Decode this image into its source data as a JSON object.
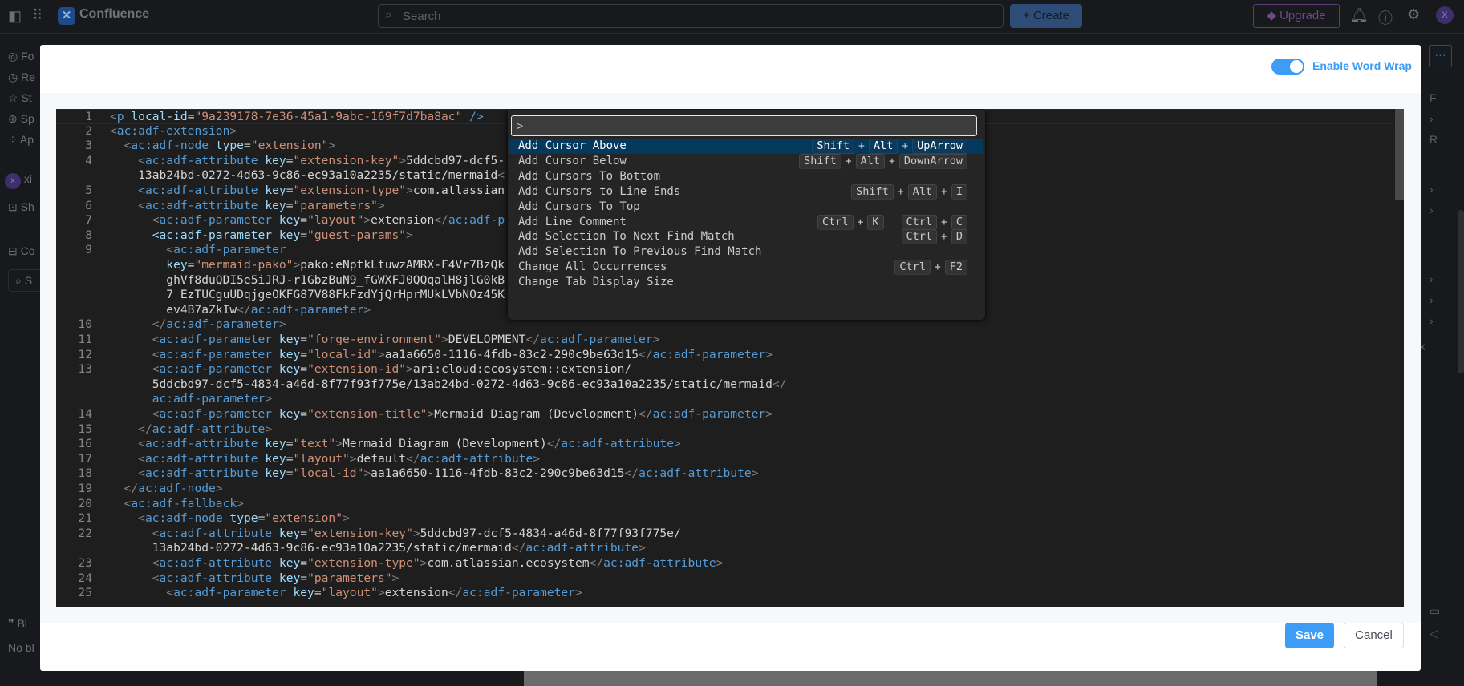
{
  "topbar": {
    "app_name": "Confluence",
    "search_placeholder": "Search",
    "create_label": "+ Create",
    "upgrade_label": "Upgrade",
    "avatar_initial": "X"
  },
  "sidebar": {
    "items": [
      "Fo",
      "Re",
      "St",
      "Sp",
      "Ap"
    ],
    "user": "xi",
    "user_initial": "x",
    "shortcut": "Sh",
    "content": "Co",
    "search": "S",
    "blog": "Bl",
    "no_blog": "No bl"
  },
  "right_panel": {
    "items": [
      "F",
      "R",
      "k"
    ]
  },
  "modal": {
    "word_wrap_label": "Enable Word Wrap",
    "word_wrap_enabled": true,
    "save_label": "Save",
    "cancel_label": "Cancel"
  },
  "editor": {
    "rows": [
      {
        "n": "1",
        "t": "<p local-id=\"9a239178-7e36-45a1-9abc-169f7d7ba8ac\" />"
      },
      {
        "n": "2",
        "t": "<ac:adf-extension>"
      },
      {
        "n": "3",
        "t": "  <ac:adf-node type=\"extension\">"
      },
      {
        "n": "4",
        "t": "    <ac:adf-attribute key=\"extension-key\">5ddcbd97-dcf5-"
      },
      {
        "n": "",
        "t": "    13ab24bd-0272-4d63-9c86-ec93a10a2235/static/mermaid<"
      },
      {
        "n": "5",
        "t": "    <ac:adf-attribute key=\"extension-type\">com.atlassian"
      },
      {
        "n": "6",
        "t": "    <ac:adf-attribute key=\"parameters\">"
      },
      {
        "n": "7",
        "t": "      <ac:adf-parameter key=\"layout\">extension</ac:adf-p"
      },
      {
        "n": "8",
        "t": "      <ac:adf-parameter key=\"guest-params\">"
      },
      {
        "n": "9",
        "t": "        <ac:adf-parameter"
      },
      {
        "n": "",
        "t": "        key=\"mermaid-pako\">pako:eNptkLtuwzAMRX-F4Vr7BzQk"
      },
      {
        "n": "",
        "t": "        ghVf8duQDI5e5iJRJ-r1GbzBuN9_fGWXFJ0QQqalH8jlG0kB"
      },
      {
        "n": "",
        "t": "        7_EzTUCguUDqjgeOKFG87V88FkFzdYjQrHprMUkLVbNOz45K"
      },
      {
        "n": "",
        "t": "        ev4B7aZkIw</ac:adf-parameter>"
      },
      {
        "n": "10",
        "t": "      </ac:adf-parameter>"
      },
      {
        "n": "11",
        "t": "      <ac:adf-parameter key=\"forge-environment\">DEVELOPMENT</ac:adf-parameter>"
      },
      {
        "n": "12",
        "t": "      <ac:adf-parameter key=\"local-id\">aa1a6650-1116-4fdb-83c2-290c9be63d15</ac:adf-parameter>"
      },
      {
        "n": "13",
        "t": "      <ac:adf-parameter key=\"extension-id\">ari:cloud:ecosystem::extension/"
      },
      {
        "n": "",
        "t": "      5ddcbd97-dcf5-4834-a46d-8f77f93f775e/13ab24bd-0272-4d63-9c86-ec93a10a2235/static/mermaid</"
      },
      {
        "n": "",
        "t": "      ac:adf-parameter>"
      },
      {
        "n": "14",
        "t": "      <ac:adf-parameter key=\"extension-title\">Mermaid Diagram (Development)</ac:adf-parameter>"
      },
      {
        "n": "15",
        "t": "    </ac:adf-attribute>"
      },
      {
        "n": "16",
        "t": "    <ac:adf-attribute key=\"text\">Mermaid Diagram (Development)</ac:adf-attribute>"
      },
      {
        "n": "17",
        "t": "    <ac:adf-attribute key=\"layout\">default</ac:adf-attribute>"
      },
      {
        "n": "18",
        "t": "    <ac:adf-attribute key=\"local-id\">aa1a6650-1116-4fdb-83c2-290c9be63d15</ac:adf-attribute>"
      },
      {
        "n": "19",
        "t": "  </ac:adf-node>"
      },
      {
        "n": "20",
        "t": "  <ac:adf-fallback>"
      },
      {
        "n": "21",
        "t": "    <ac:adf-node type=\"extension\">"
      },
      {
        "n": "22",
        "t": "      <ac:adf-attribute key=\"extension-key\">5ddcbd97-dcf5-4834-a46d-8f77f93f775e/"
      },
      {
        "n": "",
        "t": "      13ab24bd-0272-4d63-9c86-ec93a10a2235/static/mermaid</ac:adf-attribute>"
      },
      {
        "n": "23",
        "t": "      <ac:adf-attribute key=\"extension-type\">com.atlassian.ecosystem</ac:adf-attribute>"
      },
      {
        "n": "24",
        "t": "      <ac:adf-attribute key=\"parameters\">"
      },
      {
        "n": "25",
        "t": "        <ac:adf-parameter key=\"layout\">extension</ac:adf-parameter>"
      }
    ]
  },
  "palette": {
    "input_value": ">",
    "items": [
      {
        "label": "Add Cursor Above",
        "keys": [
          [
            "Shift",
            "Alt",
            "UpArrow"
          ]
        ],
        "selected": true
      },
      {
        "label": "Add Cursor Below",
        "keys": [
          [
            "Shift",
            "Alt",
            "DownArrow"
          ]
        ]
      },
      {
        "label": "Add Cursors To Bottom",
        "keys": []
      },
      {
        "label": "Add Cursors to Line Ends",
        "keys": [
          [
            "Shift",
            "Alt",
            "I"
          ]
        ]
      },
      {
        "label": "Add Cursors To Top",
        "keys": []
      },
      {
        "label": "Add Line Comment",
        "keys": [
          [
            "Ctrl",
            "K"
          ],
          [
            "Ctrl",
            "C"
          ]
        ]
      },
      {
        "label": "Add Selection To Next Find Match",
        "keys": [
          [
            "Ctrl",
            "D"
          ]
        ]
      },
      {
        "label": "Add Selection To Previous Find Match",
        "keys": []
      },
      {
        "label": "Change All Occurrences",
        "keys": [
          [
            "Ctrl",
            "F2"
          ]
        ]
      },
      {
        "label": "Change Tab Display Size",
        "keys": []
      }
    ]
  }
}
